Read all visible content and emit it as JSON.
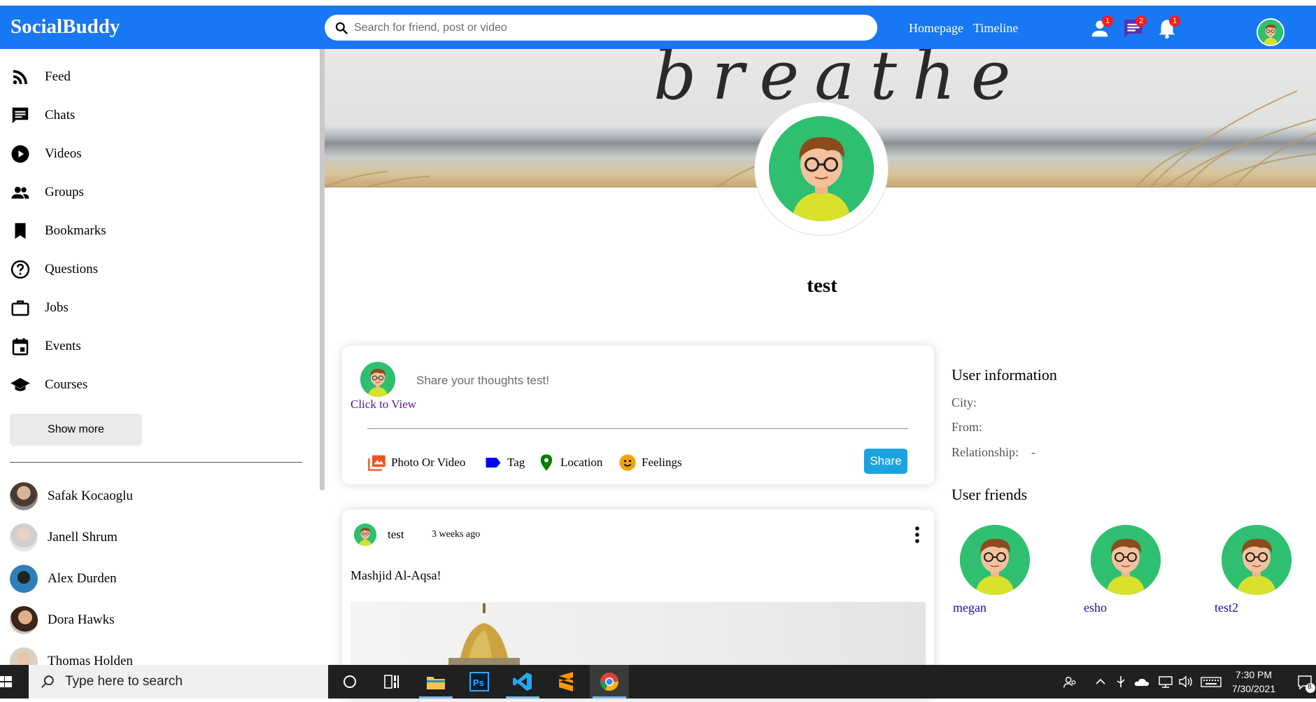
{
  "app": {
    "name": "SocialBuddy"
  },
  "search": {
    "placeholder": "Search for friend, post or video"
  },
  "topbar": {
    "links": [
      "Homepage",
      "Timeline"
    ],
    "badges": {
      "friends": "1",
      "messages": "2",
      "notifications": "1"
    }
  },
  "sidebar": {
    "items": [
      {
        "label": "Feed",
        "icon": "rss-feed-icon"
      },
      {
        "label": "Chats",
        "icon": "chat-icon"
      },
      {
        "label": "Videos",
        "icon": "play-circle-icon"
      },
      {
        "label": "Groups",
        "icon": "group-icon"
      },
      {
        "label": "Bookmarks",
        "icon": "bookmark-icon"
      },
      {
        "label": "Questions",
        "icon": "help-circle-icon"
      },
      {
        "label": "Jobs",
        "icon": "briefcase-icon"
      },
      {
        "label": "Events",
        "icon": "calendar-icon"
      },
      {
        "label": "Courses",
        "icon": "school-icon"
      }
    ],
    "show_more": "Show more",
    "friends": [
      "Safak Kocaoglu",
      "Janell Shrum",
      "Alex Durden",
      "Dora Hawks",
      "Thomas Holden"
    ]
  },
  "cover": {
    "text": "breathe"
  },
  "profile": {
    "name": "test"
  },
  "share": {
    "placeholder": "Share your thoughts test!",
    "click_to_view": "Click to View",
    "options": [
      "Photo Or Video",
      "Tag",
      "Location",
      "Feelings"
    ],
    "button": "Share",
    "colors": {
      "photo": "#f4511e",
      "tag": "#0000ff",
      "location": "#008000",
      "feelings": "#f0a30a",
      "share": "#1aa3df"
    }
  },
  "post": {
    "user": "test",
    "time": "3 weeks ago",
    "text": "Mashjid Al-Aqsa!"
  },
  "user_info": {
    "title": "User information",
    "city_label": "City:",
    "city": "",
    "from_label": "From:",
    "from": "",
    "relationship_label": "Relationship:",
    "relationship": "-"
  },
  "user_friends": {
    "title": "User friends",
    "names": [
      "megan",
      "esho",
      "test2"
    ]
  },
  "taskbar": {
    "search_placeholder": "Type here to search",
    "time": "7:30 PM",
    "date": "7/30/2021",
    "notification_count": "8"
  }
}
